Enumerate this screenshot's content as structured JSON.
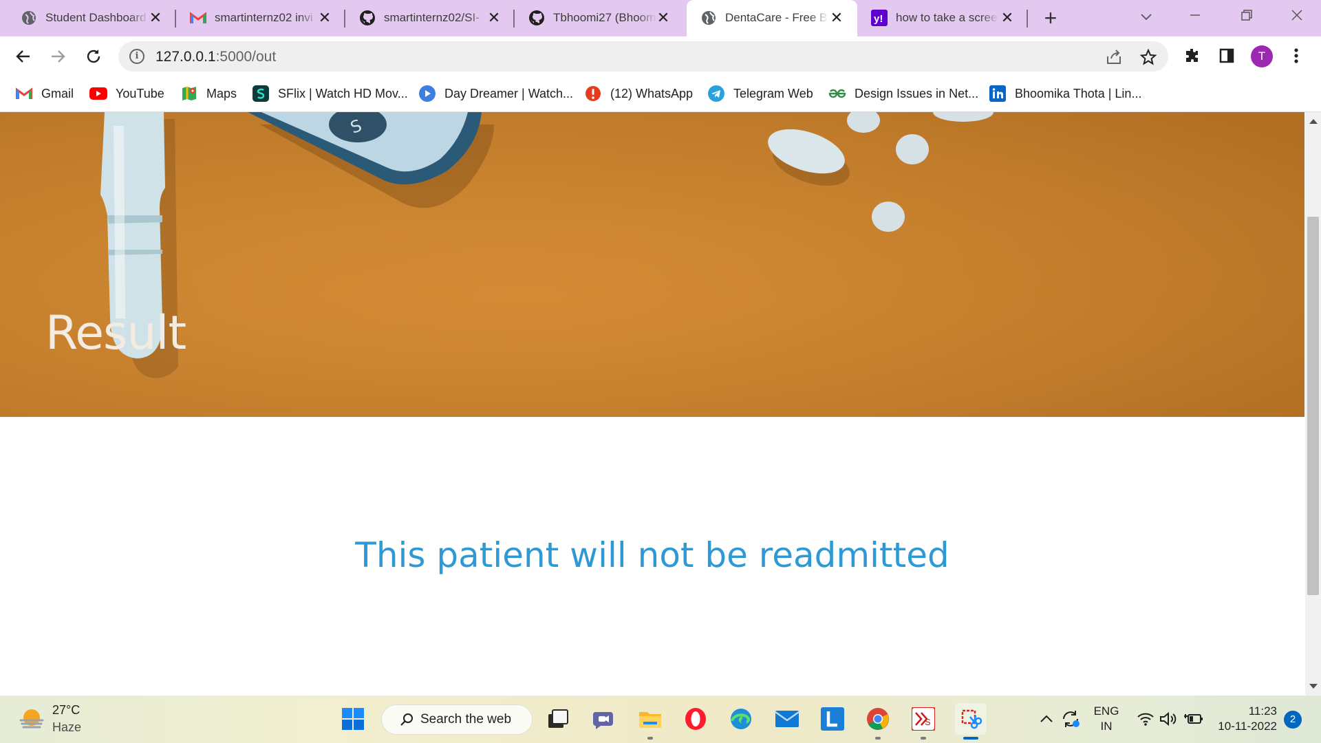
{
  "browser": {
    "tabs": [
      {
        "title": "Student Dashboard",
        "icon": "globe-icon",
        "active": false
      },
      {
        "title": "smartinternz02 invi",
        "icon": "gmail-icon",
        "active": false
      },
      {
        "title": "smartinternz02/SI-",
        "icon": "github-icon",
        "active": false
      },
      {
        "title": "Tbhoomi27 (Bhoom",
        "icon": "github-icon",
        "active": false
      },
      {
        "title": "DentaCare - Free B",
        "icon": "globe-icon",
        "active": true
      },
      {
        "title": "how to take a scree",
        "icon": "yahoo-icon",
        "active": false
      }
    ],
    "address": {
      "host": "127.0.0.1",
      "path": ":5000/out"
    },
    "profile_initial": "T",
    "bookmarks": [
      {
        "label": "Gmail",
        "icon": "gmail-icon"
      },
      {
        "label": "YouTube",
        "icon": "youtube-icon"
      },
      {
        "label": "Maps",
        "icon": "maps-icon"
      },
      {
        "label": "SFlix | Watch HD Mov...",
        "icon": "sflix-icon"
      },
      {
        "label": "Day Dreamer | Watch...",
        "icon": "play-icon"
      },
      {
        "label": "(12) WhatsApp",
        "icon": "whatsapp-icon"
      },
      {
        "label": "Telegram Web",
        "icon": "telegram-icon"
      },
      {
        "label": "Design Issues in Net...",
        "icon": "geeksforgeeks-icon"
      },
      {
        "label": "Bhoomika Thota | Lin...",
        "icon": "linkedin-icon"
      }
    ]
  },
  "page": {
    "hero_title": "Result",
    "message": "This patient will not be readmitted",
    "colors": {
      "hero_bg": "#c9832f",
      "message": "#2d9ad6"
    }
  },
  "taskbar": {
    "weather": {
      "temp": "27°C",
      "condition": "Haze"
    },
    "search_label": "Search the web",
    "lang_top": "ENG",
    "lang_bottom": "IN",
    "time": "11:23",
    "date": "10-11-2022",
    "notification_count": "2"
  }
}
